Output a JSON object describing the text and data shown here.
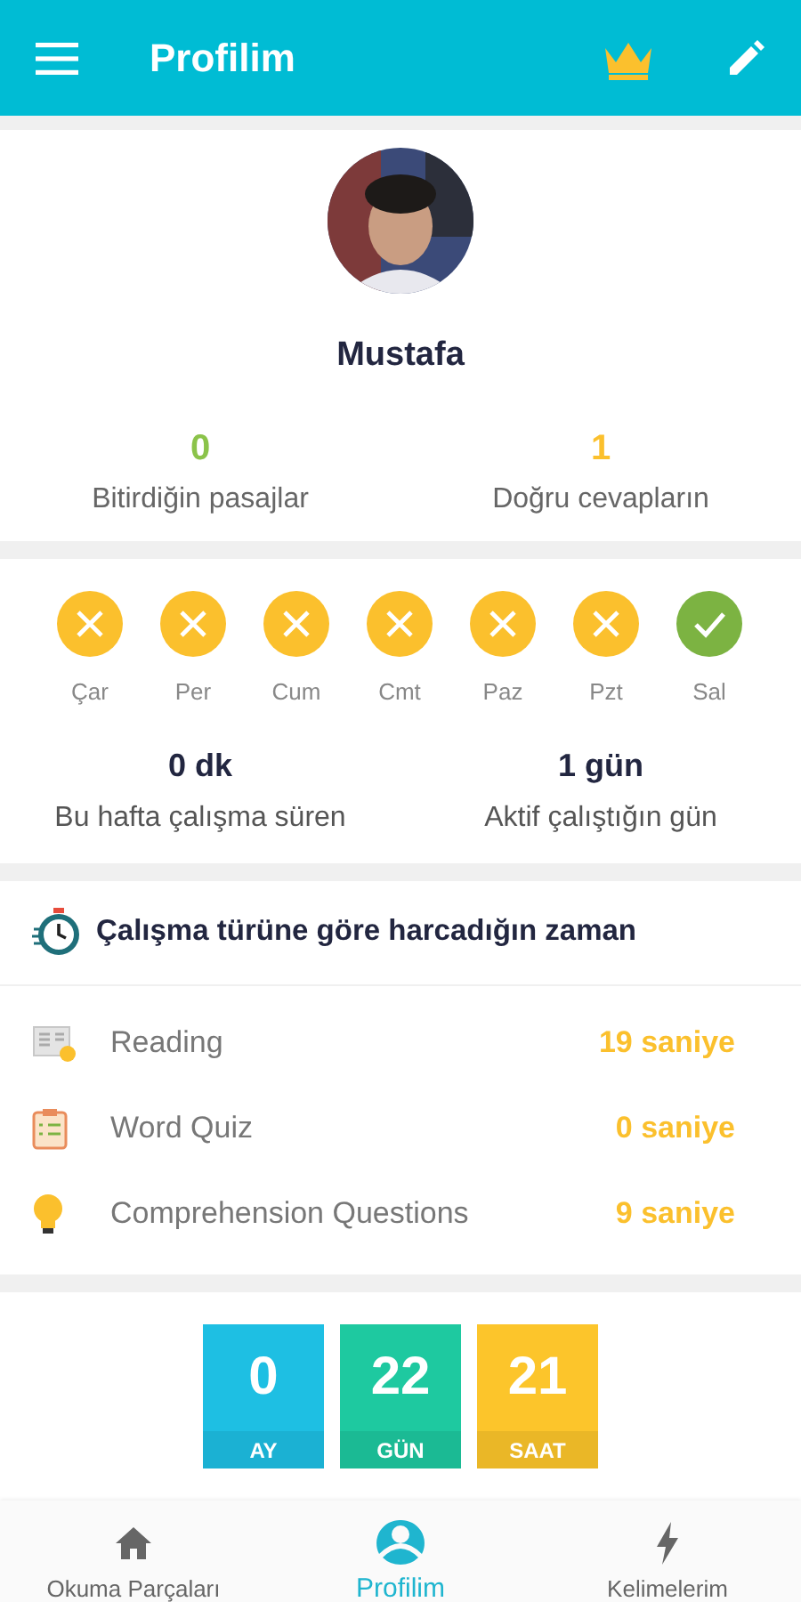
{
  "app_bar": {
    "title": "Profilim"
  },
  "profile": {
    "name": "Mustafa",
    "stats": [
      {
        "value": "0",
        "label": "Bitirdiğin pasajlar",
        "color": "#8bc34a"
      },
      {
        "value": "1",
        "label": "Doğru cevapların",
        "color": "#fbc02d"
      }
    ]
  },
  "week": {
    "days": [
      {
        "label": "Çar",
        "checked": false
      },
      {
        "label": "Per",
        "checked": false
      },
      {
        "label": "Cum",
        "checked": false
      },
      {
        "label": "Cmt",
        "checked": false
      },
      {
        "label": "Paz",
        "checked": false
      },
      {
        "label": "Pzt",
        "checked": false
      },
      {
        "label": "Sal",
        "checked": true
      }
    ],
    "stats": [
      {
        "value": "0 dk",
        "label": "Bu hafta çalışma süren"
      },
      {
        "value": "1 gün",
        "label": "Aktif çalıştığın gün"
      }
    ]
  },
  "study_time": {
    "title": "Çalışma türüne göre harcadığın zaman",
    "rows": [
      {
        "label": "Reading",
        "value": "19 saniye"
      },
      {
        "label": "Word Quiz",
        "value": "0 saniye"
      },
      {
        "label": "Comprehension Questions",
        "value": "9 saniye"
      }
    ]
  },
  "countdown": [
    {
      "value": "0",
      "unit": "AY",
      "color": "#1ebfe3"
    },
    {
      "value": "22",
      "unit": "GÜN",
      "color": "#1ec9a0"
    },
    {
      "value": "21",
      "unit": "SAAT",
      "color": "#fcc52b"
    }
  ],
  "bottom_nav": [
    {
      "label": "Okuma Parçaları",
      "selected": false
    },
    {
      "label": "Profilim",
      "selected": true
    },
    {
      "label": "Kelimelerim",
      "selected": false
    }
  ]
}
